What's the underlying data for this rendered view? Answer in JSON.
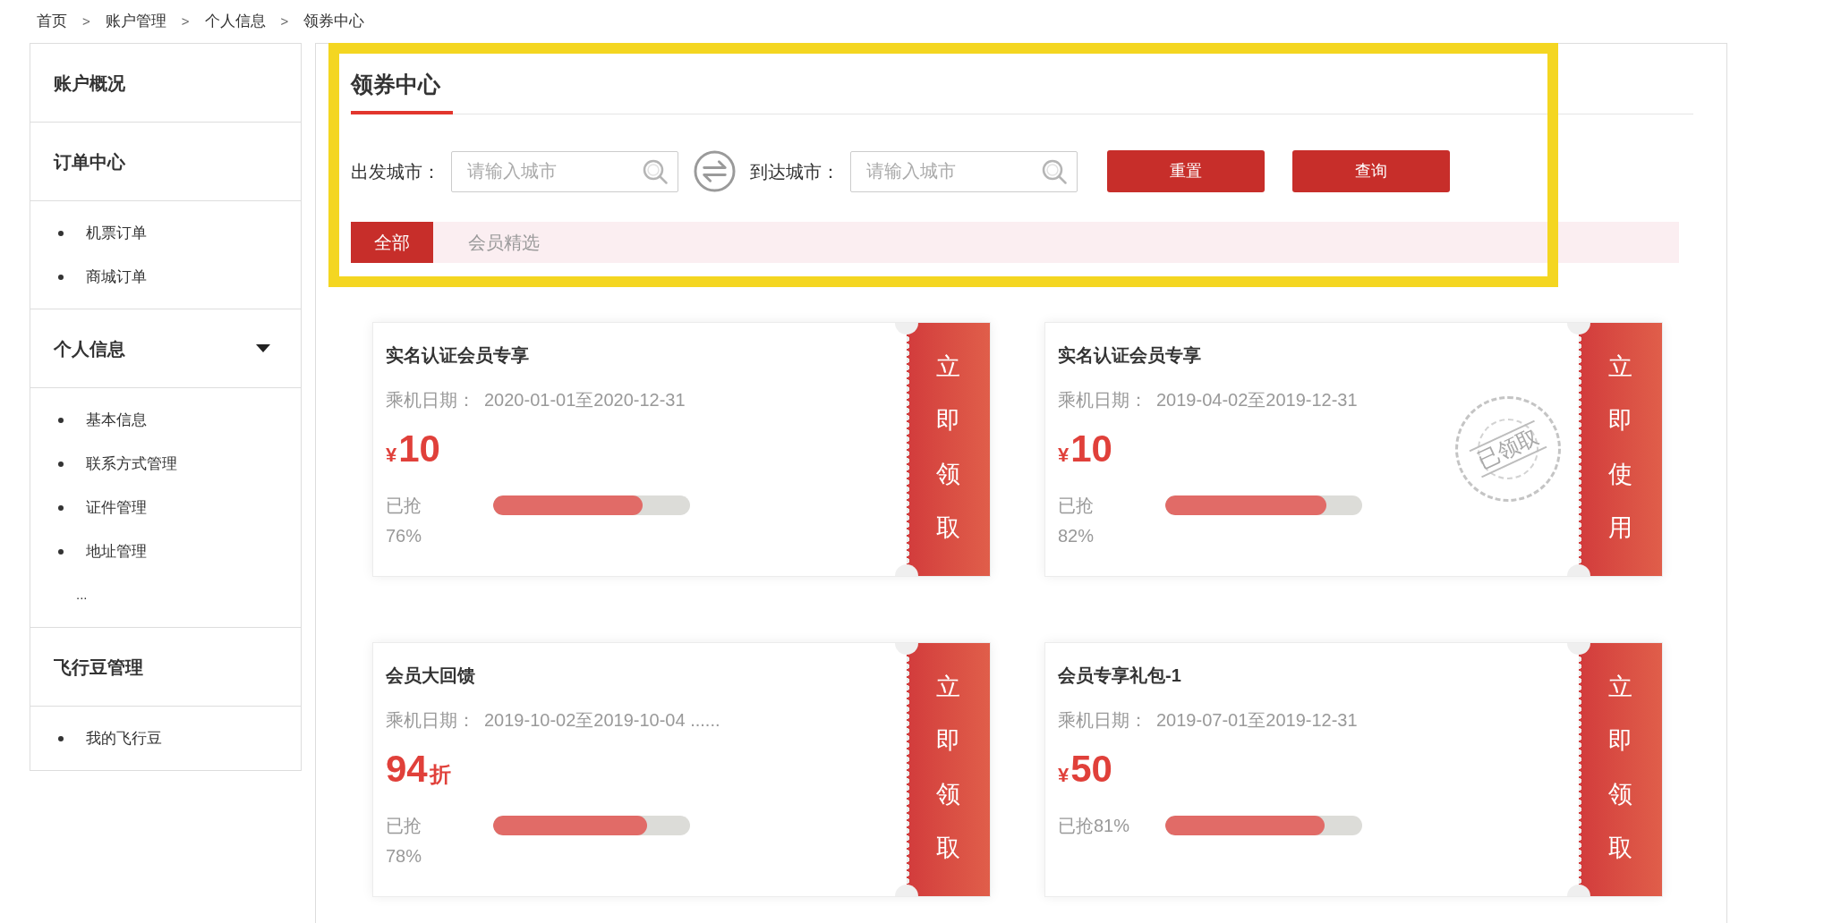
{
  "breadcrumb": [
    {
      "label": "首页"
    },
    {
      "separator": ">",
      "label": "账户管理"
    },
    {
      "separator": ">",
      "label": "个人信息"
    },
    {
      "separator": ">",
      "label": "领券中心"
    }
  ],
  "sidebar": {
    "sections": [
      {
        "title": "账户概况",
        "dropdown": false
      },
      {
        "title": "订单中心",
        "dropdown": false,
        "items": [
          "机票订单",
          "商城订单"
        ]
      },
      {
        "title": "个人信息",
        "dropdown": true,
        "items": [
          "基本信息",
          "联系方式管理",
          "证件管理",
          "地址管理"
        ],
        "more": "..."
      },
      {
        "title": "飞行豆管理",
        "dropdown": false,
        "items": [
          "我的飞行豆"
        ]
      }
    ]
  },
  "coupon_center": {
    "title": "领券中心",
    "highlighted": true,
    "search": {
      "fields": [
        {
          "label": "出发城市：",
          "placeholder": "请输入城市"
        },
        {
          "label": "到达城市：",
          "placeholder": "请输入城市"
        }
      ],
      "buttons": [
        "重置",
        "查询"
      ]
    },
    "tabs": [
      {
        "label": "全部",
        "selected": true
      },
      {
        "label": "会员精选",
        "selected": false
      }
    ]
  },
  "coupons": [
    {
      "title": "实名认证会员专享",
      "date_label": "乘机日期：",
      "dates": "2020-01-01至2020-12-31",
      "prefix": "¥",
      "amount": "10",
      "grabbed": "已抢",
      "percent": "76%",
      "level": 0.76,
      "action": "立即领取"
    },
    {
      "title": "实名认证会员专享",
      "date_label": "乘机日期：",
      "dates": "2019-04-02至2019-12-31",
      "prefix": "¥",
      "amount": "10",
      "grabbed": "已抢",
      "percent": "82%",
      "level": 0.82,
      "stamp": "已领取",
      "action": "立即使用"
    },
    {
      "title": "会员大回馈",
      "date_label": "乘机日期：",
      "dates": "2019-10-02至2019-10-04 ......",
      "amount": "94",
      "suffix": "折",
      "grabbed": "已抢",
      "percent": "78%",
      "level": 0.78,
      "action": "立即领取"
    },
    {
      "title": "会员专享礼包-1",
      "date_label": "乘机日期：",
      "dates": "2019-07-01至2019-12-31",
      "prefix": "¥",
      "amount": "50",
      "grabbed": "已抢81%",
      "level": 0.81,
      "action": "立即领取"
    }
  ]
}
